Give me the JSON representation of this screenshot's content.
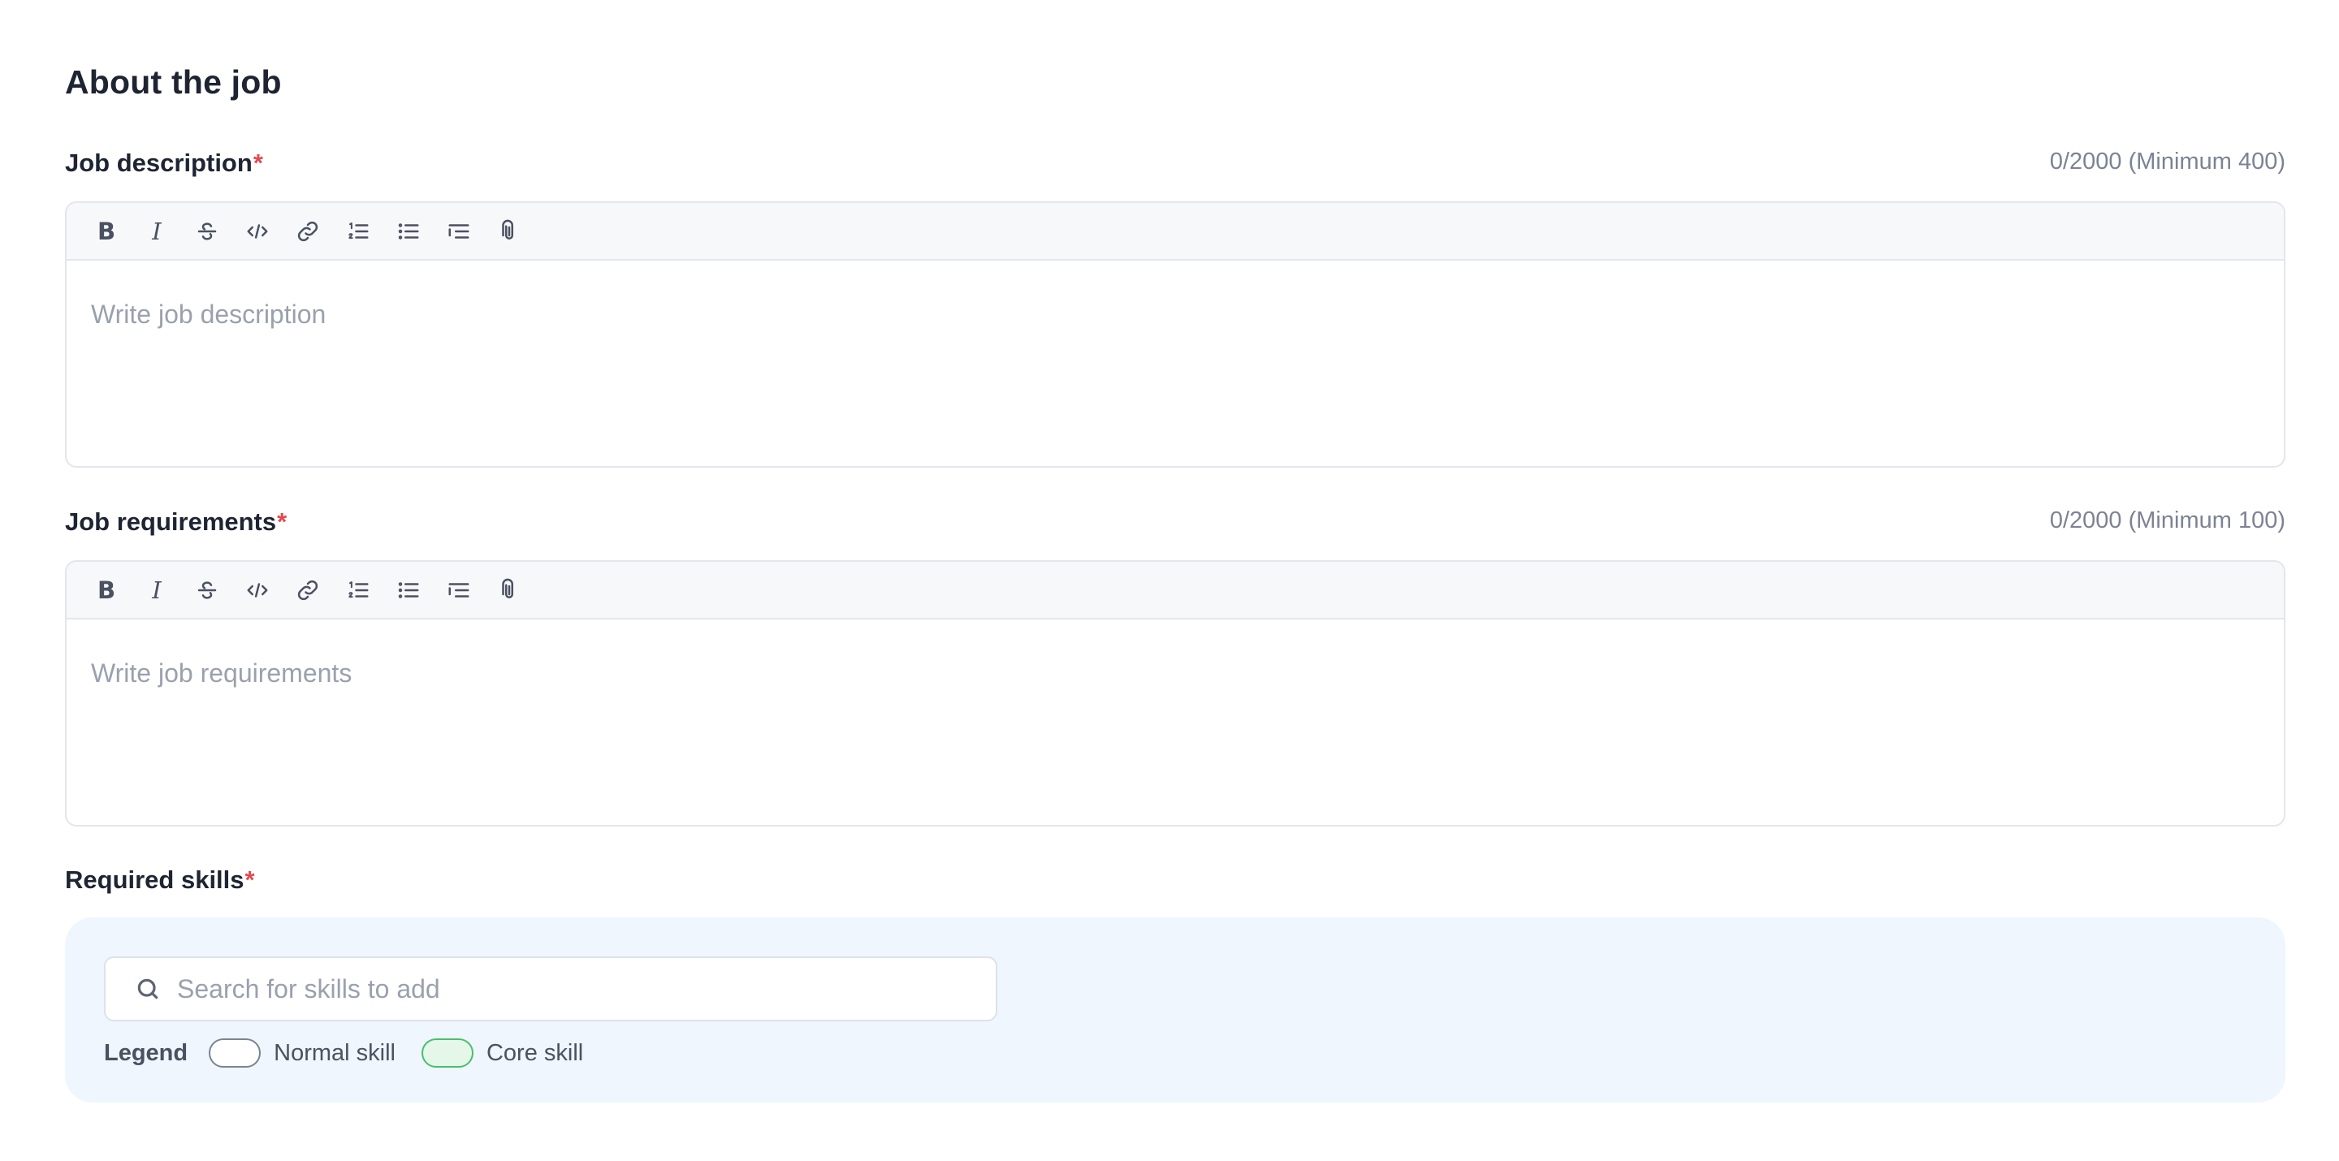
{
  "section": {
    "title": "About the job"
  },
  "job_description": {
    "label": "Job description",
    "required_mark": "*",
    "counter": "0/2000 (Minimum 400)",
    "placeholder": "Write job description"
  },
  "job_requirements": {
    "label": "Job requirements",
    "required_mark": "*",
    "counter": "0/2000 (Minimum 100)",
    "placeholder": "Write job requirements"
  },
  "toolbar": {
    "bold_label": "B",
    "italic_label": "I",
    "icons": [
      "bold-icon",
      "italic-icon",
      "strikethrough-icon",
      "code-icon",
      "link-icon",
      "ordered-list-icon",
      "bullet-list-icon",
      "indent-icon",
      "attachment-icon"
    ]
  },
  "required_skills": {
    "label": "Required skills",
    "required_mark": "*",
    "search_placeholder": "Search for skills to add",
    "legend": {
      "title": "Legend",
      "normal_label": "Normal skill",
      "core_label": "Core skill"
    }
  },
  "colors": {
    "required": "#e5484d",
    "panel_bg": "#eff6fe",
    "core_chip_border": "#4bbf6b",
    "core_chip_bg": "#e4f7e9"
  }
}
